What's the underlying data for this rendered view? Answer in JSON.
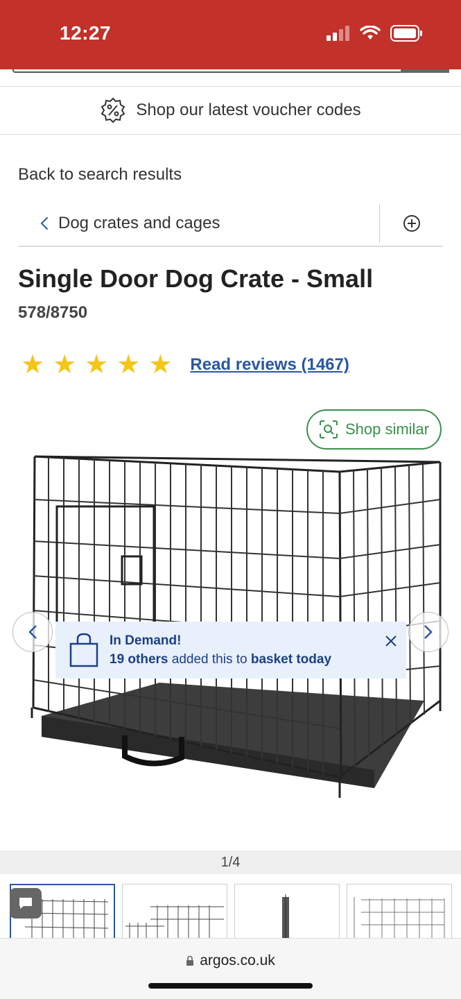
{
  "status_bar": {
    "time": "12:27",
    "color": "#c2312a"
  },
  "voucher": {
    "label": "Shop our latest voucher codes",
    "icon": "voucher-percent-icon"
  },
  "back_link": "Back to search results",
  "category": {
    "label": "Dog crates and cages",
    "expand_icon": "plus-circle-icon"
  },
  "product": {
    "title": "Single Door Dog Crate - Small",
    "sku": "578/8750",
    "rating": 5,
    "reviews_label": "Read reviews (1467)"
  },
  "gallery": {
    "shop_similar_label": "Shop similar",
    "counter": "1/4",
    "total_images": 4
  },
  "demand_banner": {
    "title": "In Demand!",
    "count_text": "19 others",
    "middle_text": "added this to",
    "end_text": "basket today"
  },
  "browser": {
    "url": "argos.co.uk"
  },
  "colors": {
    "brand_red": "#c2312a",
    "link_blue": "#2a56a3",
    "green": "#3a8f4a",
    "star": "#f5c518"
  }
}
